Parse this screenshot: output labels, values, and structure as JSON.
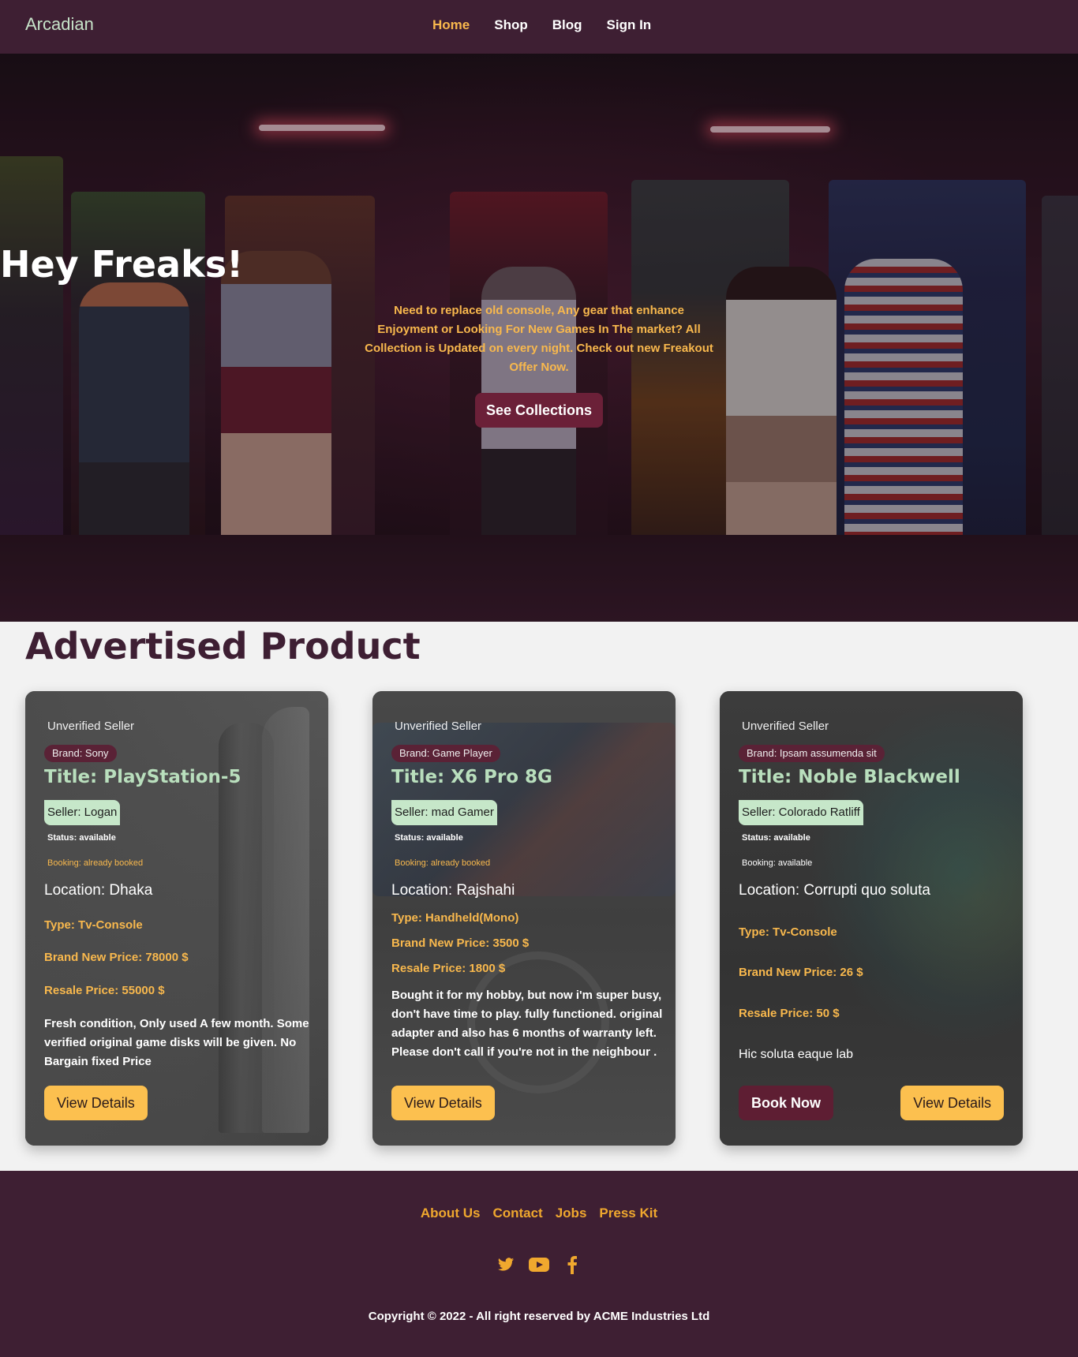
{
  "navbar": {
    "brand": "Arcadian",
    "links": [
      {
        "label": "Home",
        "active": true
      },
      {
        "label": "Shop"
      },
      {
        "label": "Blog"
      },
      {
        "label": "Sign In"
      }
    ]
  },
  "hero": {
    "title": "Hey Freaks!",
    "text": "Need to replace old console, Any gear that enhance Enjoyment or Looking For New Games In The market? All Collection is Updated on every night. Check out new Freakout Offer Now.",
    "button": "See Collections"
  },
  "advertised": {
    "title": "Advertised Product",
    "cards": [
      {
        "seller_status": "Unverified Seller",
        "brand": "Brand: Sony",
        "title": "Title: PlayStation-5",
        "seller": "Seller: Logan",
        "status": "Status: available",
        "booking": "Booking: already booked",
        "location": "Location: Dhaka",
        "type": "Type: Tv-Console",
        "new_price": "Brand New Price: 78000 $",
        "resale_price": "Resale Price: 55000 $",
        "description": "Fresh condition, Only used A few month. Some verified original game disks will be given. No Bargain fixed Price",
        "view_button": "View Details"
      },
      {
        "seller_status": "Unverified Seller",
        "brand": "Brand: Game Player",
        "title": "Title: X6 Pro 8G",
        "seller": "Seller: mad Gamer",
        "status": "Status: available",
        "booking": "Booking: already booked",
        "location": "Location: Rajshahi",
        "type": "Type: Handheld(Mono)",
        "new_price": "Brand New Price: 3500 $",
        "resale_price": "Resale Price: 1800 $",
        "description": "Bought it for my hobby, but now i'm super busy, don't have time to play. fully functioned. original adapter and also has 6 months of warranty left. Please don't call if you're not in the neighbour .",
        "view_button": "View Details"
      },
      {
        "seller_status": "Unverified Seller",
        "brand": "Brand: Ipsam assumenda sit",
        "title": "Title: Noble Blackwell",
        "seller": "Seller: Colorado Ratliff",
        "status": "Status: available",
        "booking": "Booking: available",
        "location": "Location: Corrupti quo soluta",
        "type": "Type: Tv-Console",
        "new_price": "Brand New Price: 26 $",
        "resale_price": "Resale Price: 50 $",
        "description": "Hic soluta eaque lab",
        "book_button": "Book Now",
        "view_button": "View Details"
      }
    ]
  },
  "footer": {
    "links": [
      "About Us",
      "Contact",
      "Jobs",
      "Press Kit"
    ],
    "social": [
      "twitter-icon",
      "youtube-icon",
      "facebook-icon"
    ],
    "copyright": "Copyright © 2022 - All right reserved by ACME Industries Ltd"
  },
  "colors": {
    "primary": "#3e1f33",
    "accent": "#f8b84d",
    "button_dark": "#6b2038",
    "seller_badge": "#c6e7c9",
    "title_green": "#b9dfbd"
  }
}
